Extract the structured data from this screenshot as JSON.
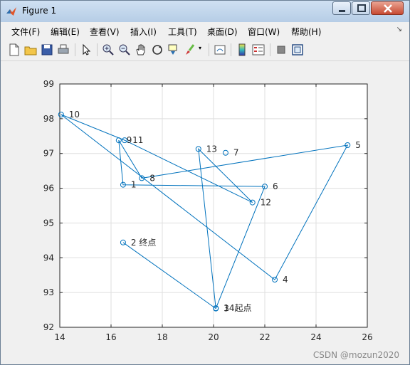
{
  "window": {
    "title": "Figure 1",
    "controls": [
      "minimize",
      "maximize",
      "close"
    ]
  },
  "menubar": {
    "items": [
      "文件(F)",
      "编辑(E)",
      "查看(V)",
      "插入(I)",
      "工具(T)",
      "桌面(D)",
      "窗口(W)",
      "帮助(H)"
    ]
  },
  "toolbar": {
    "buttons": [
      "new-figure",
      "open-file",
      "save-figure",
      "print-figure",
      "edit-plot",
      "zoom-in",
      "zoom-out",
      "pan",
      "rotate-3d",
      "data-cursor",
      "brush",
      "link-plot",
      "insert-colorbar",
      "insert-legend",
      "hide-plot-tools",
      "show-plot-tools"
    ]
  },
  "chart_data": {
    "type": "line",
    "xlim": [
      14,
      26
    ],
    "ylim": [
      92,
      99
    ],
    "xticks": [
      "14",
      "16",
      "18",
      "20",
      "22",
      "24",
      "26"
    ],
    "yticks": [
      "92",
      "93",
      "94",
      "95",
      "96",
      "97",
      "98",
      "99"
    ],
    "grid": true,
    "series_color": "#0072BD",
    "marker": "open-circle",
    "points": [
      {
        "x": 16.47,
        "y": 96.1,
        "label": "1"
      },
      {
        "x": 16.47,
        "y": 94.44,
        "label": "2  终点"
      },
      {
        "x": 20.09,
        "y": 92.54,
        "label": "3"
      },
      {
        "x": 22.39,
        "y": 93.37,
        "label": "4"
      },
      {
        "x": 25.23,
        "y": 97.24,
        "label": "5"
      },
      {
        "x": 22.0,
        "y": 96.05,
        "label": "6"
      },
      {
        "x": 20.47,
        "y": 97.02,
        "label": "7"
      },
      {
        "x": 17.2,
        "y": 96.29,
        "label": "8"
      },
      {
        "x": 16.3,
        "y": 97.38,
        "label": "9"
      },
      {
        "x": 14.05,
        "y": 98.12,
        "label": "10"
      },
      {
        "x": 16.53,
        "y": 97.38,
        "label": "11"
      },
      {
        "x": 21.52,
        "y": 95.59,
        "label": "12"
      },
      {
        "x": 19.41,
        "y": 97.13,
        "label": "13"
      },
      {
        "x": 20.09,
        "y": 92.55,
        "label": "14起点"
      }
    ],
    "path_order": [
      14,
      13,
      12,
      11,
      10,
      4,
      5,
      8,
      9,
      1,
      6,
      3,
      2
    ]
  },
  "footer": {
    "watermark": "CSDN @mozun2020"
  }
}
